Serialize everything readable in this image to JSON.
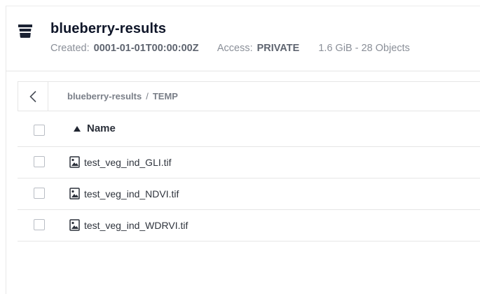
{
  "bucket": {
    "icon": "bucket-icon",
    "name": "blueberry-results",
    "created_label": "Created:",
    "created_value": "0001-01-01T00:00:00Z",
    "access_label": "Access:",
    "access_value": "PRIVATE",
    "size_summary": "1.6 GiB - 28 Objects"
  },
  "browser": {
    "back_icon": "chevron-left-icon",
    "breadcrumb": [
      "blueberry-results",
      "TEMP"
    ],
    "breadcrumb_separator": "/",
    "column_name": "Name",
    "sort_icon": "sort-ascending-icon",
    "files": [
      {
        "name": "test_veg_ind_GLI.tif",
        "icon": "image-file-icon"
      },
      {
        "name": "test_veg_ind_NDVI.tif",
        "icon": "image-file-icon"
      },
      {
        "name": "test_veg_ind_WDRVI.tif",
        "icon": "image-file-icon"
      }
    ]
  },
  "colors": {
    "title": "#0f1629",
    "muted": "#8a8f98",
    "border": "#e6e6e6",
    "icon": "#1b2233"
  }
}
